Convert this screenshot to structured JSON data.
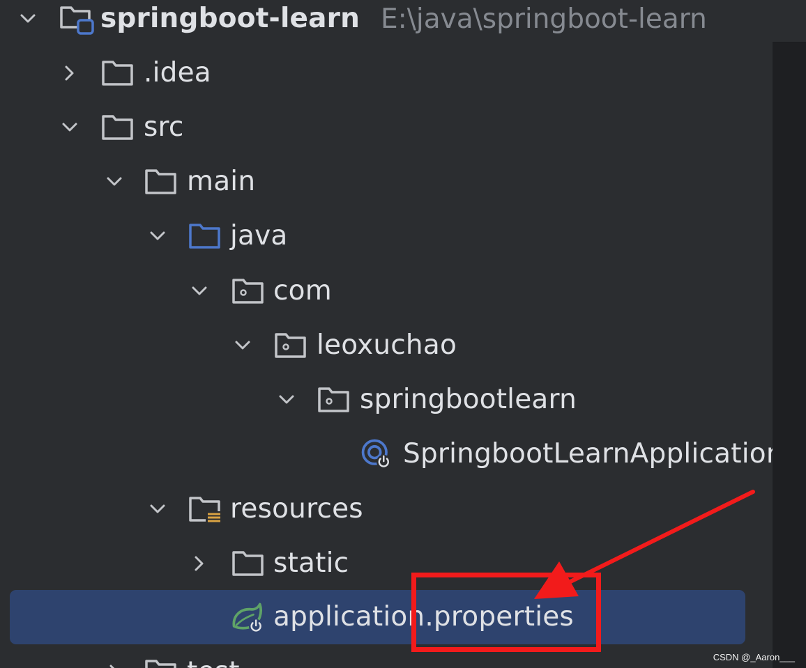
{
  "project": {
    "name": "springboot-learn",
    "path": "E:\\java\\springboot-learn"
  },
  "tree": {
    "idea": ".idea",
    "src": "src",
    "main": "main",
    "java": "java",
    "com": "com",
    "leoxuchao": "leoxuchao",
    "springbootlearn": "springbootlearn",
    "app_class": "SpringbootLearnApplication",
    "resources": "resources",
    "static": "static",
    "properties": "application.properties",
    "test": "test"
  },
  "watermark": "CSDN @_Aaron___",
  "colors": {
    "background": "#2b2d30",
    "selection": "#2e436e",
    "text": "#dfe1e5",
    "muted_text": "#868a91",
    "source_folder": "#4d78cc",
    "spring_green": "#5fa367",
    "annotation_red": "#f21b1b"
  },
  "icons": {
    "expanded": "chevron-down-icon",
    "collapsed": "chevron-right-icon",
    "folder": "folder-icon",
    "module": "module-folder-icon",
    "source_root": "source-root-folder-icon",
    "package": "package-icon",
    "resources_root": "resources-root-folder-icon",
    "spring_boot_app": "spring-boot-app-icon",
    "spring_properties": "spring-properties-icon"
  }
}
